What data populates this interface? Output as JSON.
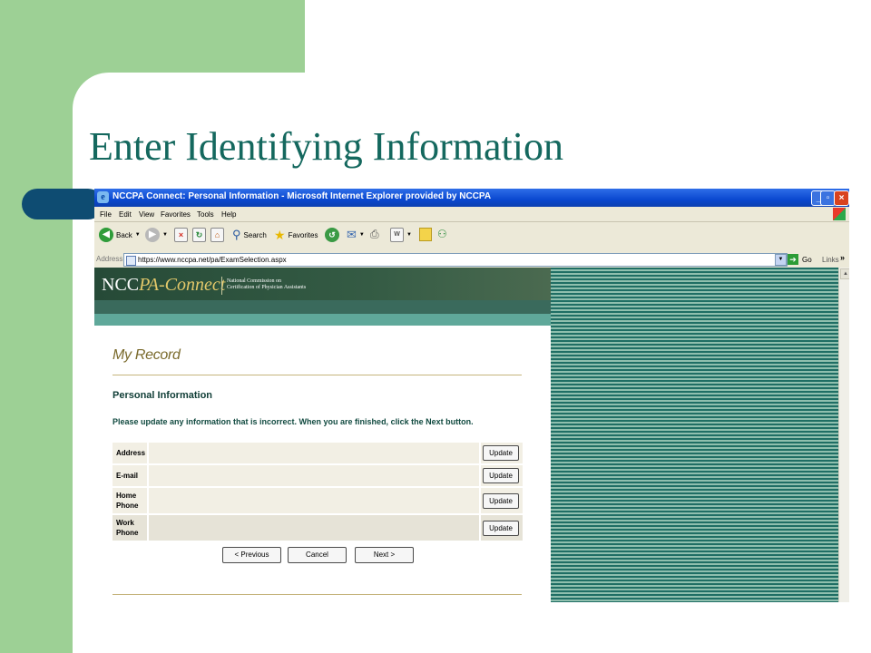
{
  "slide": {
    "title": "Enter Identifying Information"
  },
  "window": {
    "title": "NCCPA Connect: Personal Information - Microsoft Internet Explorer provided by NCCPA"
  },
  "menu": [
    "File",
    "Edit",
    "View",
    "Favorites",
    "Tools",
    "Help"
  ],
  "toolbar": {
    "back": "Back",
    "search": "Search",
    "favorites": "Favorites"
  },
  "address": {
    "label": "Address",
    "url": "https://www.nccpa.net/pa/ExamSelection.aspx",
    "go": "Go",
    "links": "Links"
  },
  "site": {
    "brand_main": "NCC",
    "brand_pa": "PA-Connect",
    "brand_sub_line1": "National Commission on",
    "brand_sub_line2": "Certification of Physician Assistants"
  },
  "form": {
    "section_title": "My Record",
    "heading": "Personal Information",
    "instructions": "Please update any information that is incorrect. When you are finished, click the Next button.",
    "rows": [
      {
        "label": "Address",
        "button": "Update"
      },
      {
        "label": "E-mail",
        "button": "Update"
      },
      {
        "label_line1": "Home",
        "label_line2": "Phone",
        "button": "Update"
      },
      {
        "label_line1": "Work",
        "label_line2": "Phone",
        "button": "Update"
      }
    ],
    "previous": "< Previous",
    "cancel": "Cancel",
    "next": "Next >"
  }
}
